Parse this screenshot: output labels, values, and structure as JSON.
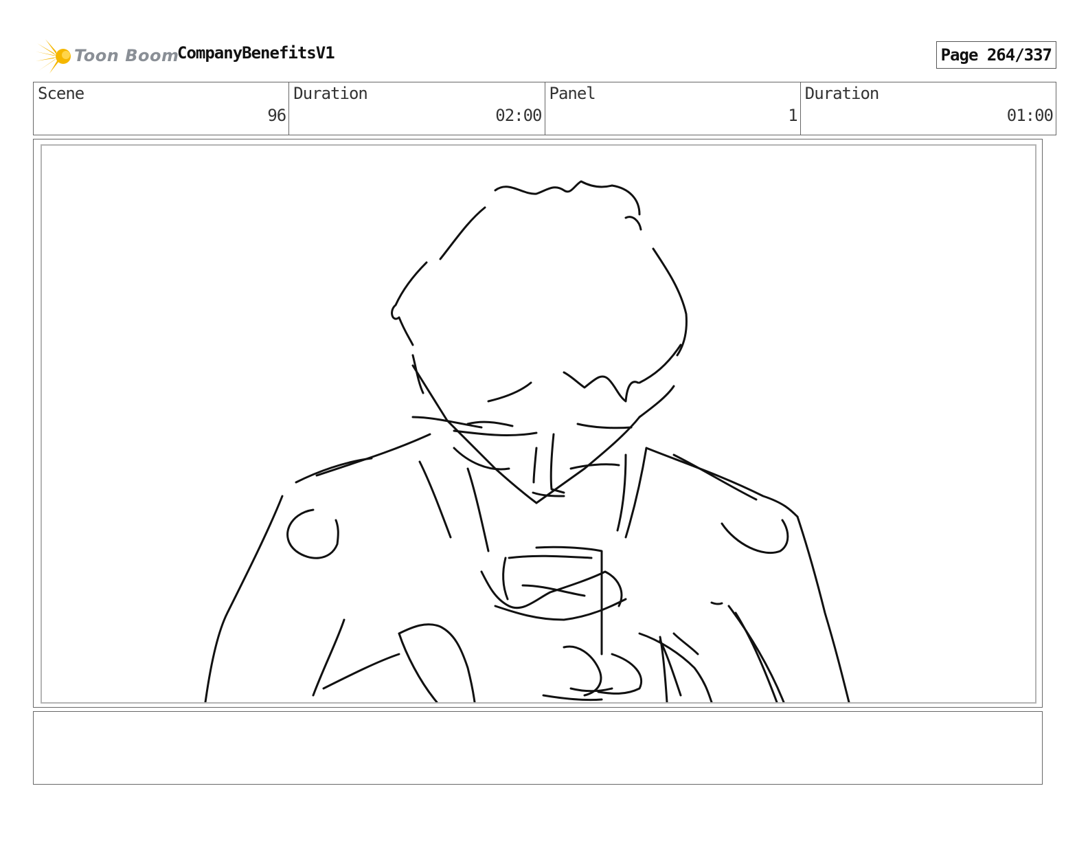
{
  "header": {
    "logo_text": "Toon Boom",
    "project_title": "CompanyBenefitsV1",
    "page_label": "Page 264/337"
  },
  "info": {
    "scene_label": "Scene",
    "scene_value": "96",
    "scene_duration_label": "Duration",
    "scene_duration_value": "02:00",
    "panel_label": "Panel",
    "panel_value": "1",
    "panel_duration_label": "Duration",
    "panel_duration_value": "01:00"
  },
  "panel": {
    "icon": "storyboard-sketch-person-looking-down-at-phone"
  },
  "notes": {
    "text": ""
  },
  "colors": {
    "logo_accent": "#f5b700",
    "logo_text": "#8a8f96",
    "border": "#666666",
    "inner_border": "#b4b4b4"
  }
}
